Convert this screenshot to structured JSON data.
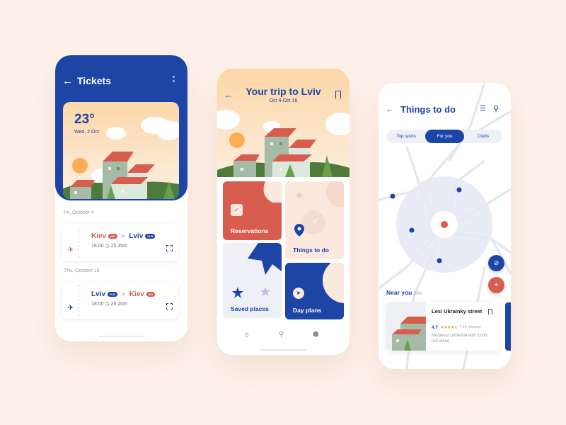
{
  "colors": {
    "background": "#fdf1ea",
    "primary": "#1c45a6",
    "accent": "#d85d4f",
    "card_peach": "#fbe9df",
    "card_gray": "#eef0f5"
  },
  "tickets_screen": {
    "title": "Tickets",
    "back_icon": "arrow-left-icon",
    "menu_icon": "more-vertical-icon",
    "weather": {
      "temperature": "23°",
      "date": "Wed, 2 Oct"
    },
    "trips": [
      {
        "day_label": "Fri, October 4",
        "from_city": "Kiev",
        "from_code": "IEV",
        "to_city": "Lviv",
        "to_code": "PLR",
        "time": "16:00",
        "duration": "2h 35m",
        "icon": "plane-departure-icon",
        "icon_color": "#d85d4f"
      },
      {
        "day_label": "Thu, October 16",
        "from_city": "Lviv",
        "from_code": "PLR",
        "to_city": "Kiev",
        "to_code": "IEV",
        "time": "18:00",
        "duration": "2h 20m",
        "icon": "plane-arrival-icon",
        "icon_color": "#1c45a6"
      }
    ],
    "separator": ">"
  },
  "trip_screen": {
    "title": "Your trip to Lviv",
    "dates": "Oct 4-Oct 16",
    "tiles": [
      {
        "label": "Reservations",
        "icon": "calendar-check-icon"
      },
      {
        "label": "Things to do",
        "icon": "map-pin-icon"
      },
      {
        "label": "Saved places",
        "icon": "star-icon"
      },
      {
        "label": "Day plans",
        "icon": "navigation-arrow-icon"
      }
    ],
    "bottom_nav": [
      {
        "label": "home",
        "icon": "home-icon",
        "active": true
      },
      {
        "label": "search",
        "icon": "search-icon",
        "active": false
      },
      {
        "label": "settings",
        "icon": "settings-icon",
        "active": false
      }
    ]
  },
  "things_screen": {
    "title": "Things to do",
    "tabs": [
      {
        "label": "Top spots",
        "active": false
      },
      {
        "label": "For you",
        "active": true
      },
      {
        "label": "Clubs",
        "active": false
      }
    ],
    "near_label": "Near you",
    "near_distance": "20m",
    "place": {
      "name": "Lesi Ukrainky street",
      "rating": "4.7",
      "stars": 4,
      "max_stars": 5,
      "reviews": "7,1k reviews",
      "description": "Medieval cathedral with iconic red dome"
    }
  }
}
